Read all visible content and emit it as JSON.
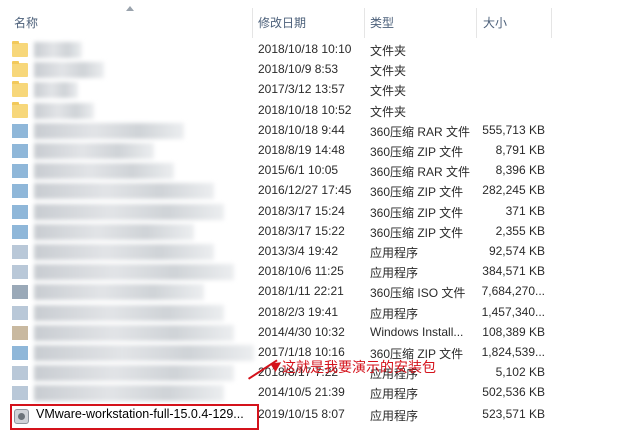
{
  "columns": {
    "name": "名称",
    "date": "修改日期",
    "type": "类型",
    "size": "大小"
  },
  "files": [
    {
      "date": "2018/10/18 10:10",
      "type": "文件夹",
      "size": "",
      "icon": "folder-icon"
    },
    {
      "date": "2018/10/9 8:53",
      "type": "文件夹",
      "size": "",
      "icon": "folder-icon"
    },
    {
      "date": "2017/3/12 13:57",
      "type": "文件夹",
      "size": "",
      "icon": "folder-icon"
    },
    {
      "date": "2018/10/18 10:52",
      "type": "文件夹",
      "size": "",
      "icon": "folder-icon"
    },
    {
      "date": "2018/10/18 9:44",
      "type": "360压缩 RAR 文件",
      "size": "555,713 KB",
      "icon": "archive-icon"
    },
    {
      "date": "2018/8/19 14:48",
      "type": "360压缩 ZIP 文件",
      "size": "8,791 KB",
      "icon": "archive-icon"
    },
    {
      "date": "2015/6/1 10:05",
      "type": "360压缩 RAR 文件",
      "size": "8,396 KB",
      "icon": "archive-icon"
    },
    {
      "date": "2016/12/27 17:45",
      "type": "360压缩 ZIP 文件",
      "size": "282,245 KB",
      "icon": "archive-icon"
    },
    {
      "date": "2018/3/17 15:24",
      "type": "360压缩 ZIP 文件",
      "size": "371 KB",
      "icon": "archive-icon"
    },
    {
      "date": "2018/3/17 15:22",
      "type": "360压缩 ZIP 文件",
      "size": "2,355 KB",
      "icon": "archive-icon"
    },
    {
      "date": "2013/3/4 19:42",
      "type": "应用程序",
      "size": "92,574 KB",
      "icon": "exe-icon"
    },
    {
      "date": "2018/10/6 11:25",
      "type": "应用程序",
      "size": "384,571 KB",
      "icon": "exe-icon"
    },
    {
      "date": "2018/1/11 22:21",
      "type": "360压缩 ISO 文件",
      "size": "7,684,270...",
      "icon": "iso-icon"
    },
    {
      "date": "2018/2/3 19:41",
      "type": "应用程序",
      "size": "1,457,340...",
      "icon": "exe-icon"
    },
    {
      "date": "2014/4/30 10:32",
      "type": "Windows Install...",
      "size": "108,389 KB",
      "icon": "installer-icon"
    },
    {
      "date": "2017/1/18 10:16",
      "type": "360压缩 ZIP 文件",
      "size": "1,824,539...",
      "icon": "archive-icon"
    },
    {
      "date": "2018/8/17 7:22",
      "type": "应用程序",
      "size": "5,102 KB",
      "icon": "exe-icon"
    },
    {
      "date": "2014/10/5 21:39",
      "type": "应用程序",
      "size": "502,536 KB",
      "icon": "exe-icon"
    }
  ],
  "highlighted_file": {
    "name": "VMware-workstation-full-15.0.4-129...",
    "date": "2019/10/15 8:07",
    "type": "应用程序",
    "size": "523,571 KB",
    "icon": "vmware-icon"
  },
  "annotation": "这就是我要演示的安装包",
  "colors": {
    "highlight": "#d4121b",
    "header_text": "#4c607a"
  }
}
